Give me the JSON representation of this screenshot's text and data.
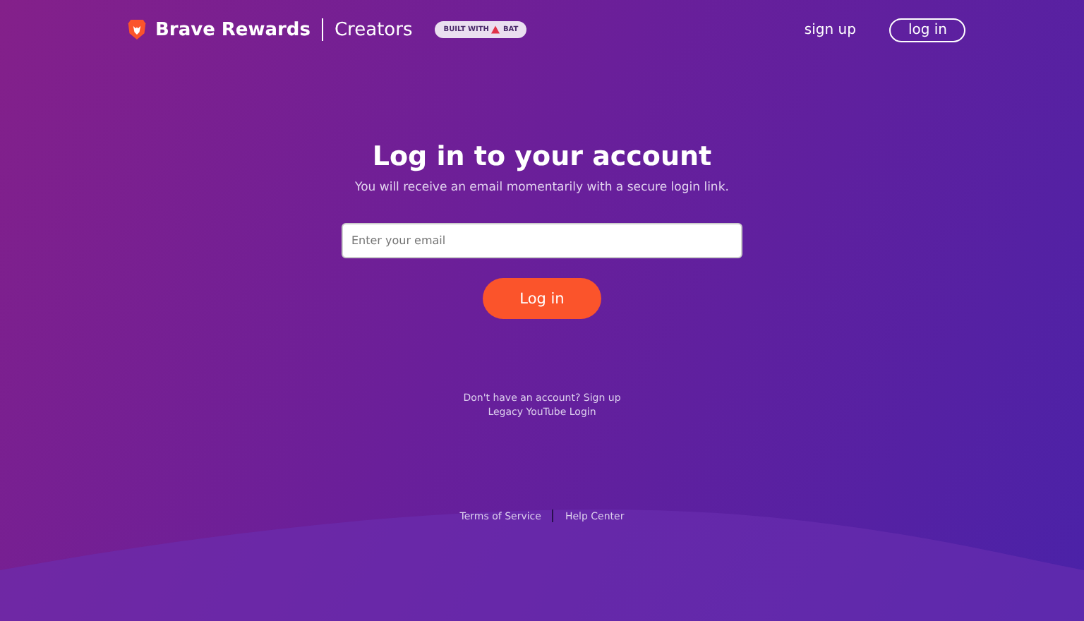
{
  "header": {
    "brand": "Brave Rewards",
    "section": "Creators",
    "badge": {
      "prefix": "BUILT WITH",
      "token": "BAT"
    },
    "nav": [
      {
        "label": "sign up",
        "kind": "link"
      },
      {
        "label": "log in",
        "kind": "outlined"
      }
    ]
  },
  "login": {
    "title": "Log in to your account",
    "subtitle": "You will receive an email momentarily with a secure login link.",
    "email": {
      "placeholder": "Enter your email"
    },
    "button": "Log in"
  },
  "links": {
    "signup_prompt": "Don't have an account?",
    "signup_link": "Sign up",
    "legacy": "Legacy YouTube Login"
  },
  "footer": [
    "Terms of Service",
    "Help Center"
  ]
}
